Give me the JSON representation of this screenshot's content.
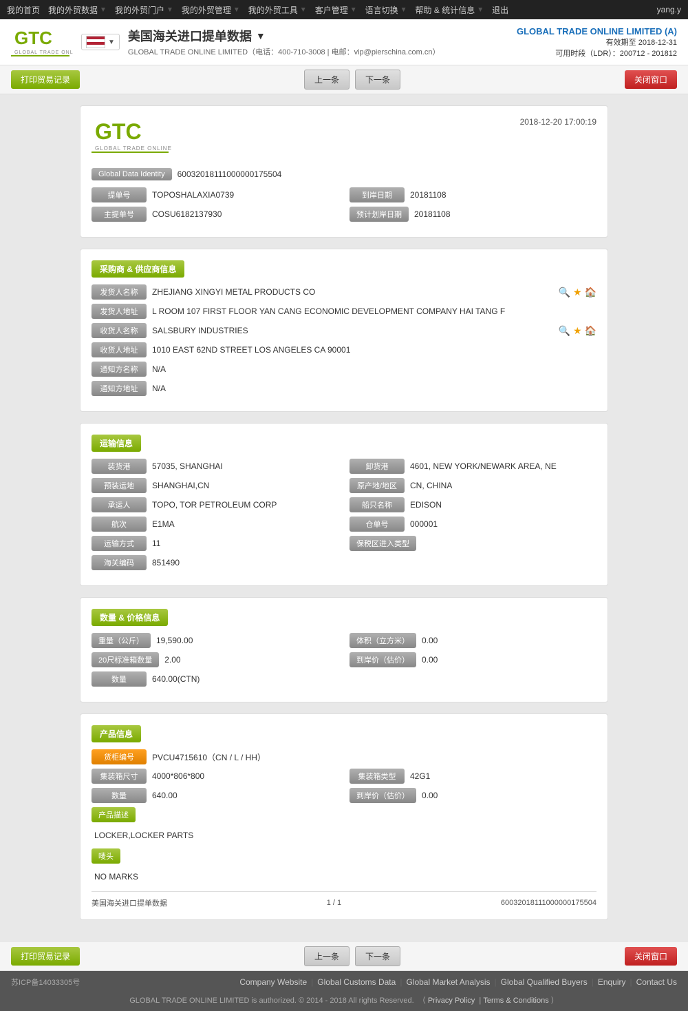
{
  "nav": {
    "items": [
      "我的首页",
      "我的外贸数据",
      "我的外贸门户",
      "我的外贸管理",
      "我的外贸工具",
      "客户管理",
      "语言切换",
      "帮助 & 统计信息",
      "退出"
    ],
    "user": "yang.y"
  },
  "header": {
    "title": "美国海关进口提单数据",
    "company_line": "GLOBAL TRADE ONLINE LIMITED（电话：400-710-3008 | 电邮：vip@pierschina.com.cn）",
    "top_company": "GLOBAL TRADE ONLINE LIMITED (A)",
    "validity": "有效期至 2018-12-31",
    "ldr": "可用时段（LDR）：200712 - 201812"
  },
  "toolbar": {
    "print_label": "打印贸易记录",
    "prev_label": "上一条",
    "next_label": "下一条",
    "close_label": "关闭窗口"
  },
  "doc": {
    "datetime": "2018-12-20 17:00:19",
    "gdi_label": "Global Data Identity",
    "gdi_value": "60032018111000000175504",
    "fields": {
      "bill_no_label": "提单号",
      "bill_no_value": "TOPOSHALAXIA0739",
      "arrival_date_label": "到岸日期",
      "arrival_date_value": "20181108",
      "master_bill_label": "主提单号",
      "master_bill_value": "COSU6182137930",
      "est_arrival_label": "预计划岸日期",
      "est_arrival_value": "20181108"
    },
    "buyer_supplier": {
      "section_title": "采购商 & 供应商信息",
      "shipper_name_label": "发货人名称",
      "shipper_name_value": "ZHEJIANG XINGYI METAL PRODUCTS CO",
      "shipper_addr_label": "发货人地址",
      "shipper_addr_value": "L ROOM 107 FIRST FLOOR YAN CANG ECONOMIC DEVELOPMENT COMPANY HAI TANG F",
      "consignee_name_label": "收货人名称",
      "consignee_name_value": "SALSBURY INDUSTRIES",
      "consignee_addr_label": "收货人地址",
      "consignee_addr_value": "1010 EAST 62ND STREET LOS ANGELES CA 90001",
      "notify_name_label": "通知方名称",
      "notify_name_value": "N/A",
      "notify_addr_label": "通知方地址",
      "notify_addr_value": "N/A"
    },
    "transport": {
      "section_title": "运输信息",
      "loading_port_label": "装货港",
      "loading_port_value": "57035, SHANGHAI",
      "discharge_port_label": "卸货港",
      "discharge_port_value": "4601, NEW YORK/NEWARK AREA, NE",
      "pre_carriage_label": "预装运地",
      "pre_carriage_value": "SHANGHAI,CN",
      "origin_label": "原产地/地区",
      "origin_value": "CN, CHINA",
      "carrier_label": "承运人",
      "carrier_value": "TOPO, TOR PETROLEUM CORP",
      "vessel_label": "船只名称",
      "vessel_value": "EDISON",
      "voyage_label": "航次",
      "voyage_value": "E1MA",
      "warehouse_label": "仓单号",
      "warehouse_value": "000001",
      "transport_mode_label": "运输方式",
      "transport_mode_value": "11",
      "bonded_label": "保税区进入类型",
      "bonded_value": "",
      "hs_code_label": "海关编码",
      "hs_code_value": "851490"
    },
    "quantity_price": {
      "section_title": "数量 & 价格信息",
      "weight_label": "重量（公斤）",
      "weight_value": "19,590.00",
      "volume_label": "体积（立方米）",
      "volume_value": "0.00",
      "twenty_ft_label": "20尺标准箱数量",
      "twenty_ft_value": "2.00",
      "arrival_price_label": "到岸价（估价）",
      "arrival_price_value": "0.00",
      "quantity_label": "数量",
      "quantity_value": "640.00(CTN)"
    },
    "product": {
      "section_title": "产品信息",
      "container_no_label": "货柜编号",
      "container_no_value": "PVCU4715610（CN / L / HH）",
      "container_size_label": "集装箱尺寸",
      "container_size_value": "4000*806*800",
      "container_type_label": "集装箱类型",
      "container_type_value": "42G1",
      "quantity_label": "数量",
      "quantity_value": "640.00",
      "arrive_price_label": "到岸价（估价）",
      "arrive_price_value": "0.00",
      "desc_label": "产品描述",
      "desc_value": "LOCKER,LOCKER PARTS",
      "marks_label": "唛头",
      "marks_value": "NO MARKS"
    },
    "footer": {
      "source": "美国海关进口提单数据",
      "page": "1 / 1",
      "id": "60032018111000000175504"
    }
  },
  "footer": {
    "icp": "苏ICP备14033305号",
    "links": [
      "Company Website",
      "Global Customs Data",
      "Global Market Analysis",
      "Global Qualified Buyers",
      "Enquiry",
      "Contact Us"
    ],
    "copyright": "GLOBAL TRADE ONLINE LIMITED is authorized. © 2014 - 2018 All rights Reserved.",
    "privacy": "Privacy Policy",
    "terms": "Terms & Conditions"
  }
}
